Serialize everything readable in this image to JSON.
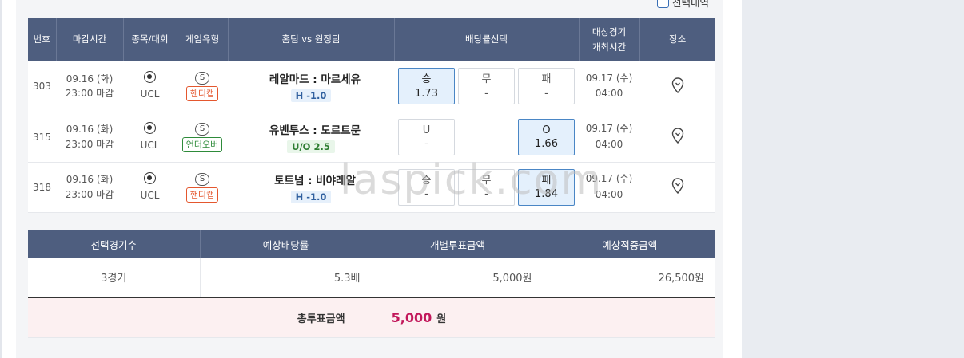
{
  "select_toggle": {
    "label": "선택내역"
  },
  "table": {
    "headers": {
      "no": "번호",
      "deadline": "마감시간",
      "league": "종목/대회",
      "game_type": "게임유형",
      "match": "홈팀 vs 원정팀",
      "odds": "배당률선택",
      "event_time_1": "대상경기",
      "event_time_2": "개최시간",
      "venue": "장소"
    },
    "rows": [
      {
        "no": "303",
        "date": "09.16 (화)",
        "deadline": "23:00 마감",
        "league": "UCL",
        "type_s": "S",
        "type_tag": "핸디캡",
        "teams": "레알마드 : 마르세유",
        "handicap": "H -1.0",
        "odds": [
          {
            "label": "승",
            "value": "1.73",
            "selected": true
          },
          {
            "label": "무",
            "value": "-",
            "selected": false
          },
          {
            "label": "패",
            "value": "-",
            "selected": false
          }
        ],
        "event_date": "09.17 (수)",
        "event_time": "04:00"
      },
      {
        "no": "315",
        "date": "09.16 (화)",
        "deadline": "23:00 마감",
        "league": "UCL",
        "type_s": "S",
        "type_tag": "언더오버",
        "teams": "유벤투스 : 도르트문",
        "handicap": "U/O 2.5",
        "odds": [
          {
            "label": "U",
            "value": "-",
            "selected": false
          },
          {
            "label": "",
            "value": "",
            "selected": false
          },
          {
            "label": "O",
            "value": "1.66",
            "selected": true
          }
        ],
        "event_date": "09.17 (수)",
        "event_time": "04:00"
      },
      {
        "no": "318",
        "date": "09.16 (화)",
        "deadline": "23:00 마감",
        "league": "UCL",
        "type_s": "S",
        "type_tag": "핸디캡",
        "teams": "토트넘 : 비야레알",
        "handicap": "H -1.0",
        "odds": [
          {
            "label": "승",
            "value": "-",
            "selected": false
          },
          {
            "label": "무",
            "value": "-",
            "selected": false
          },
          {
            "label": "패",
            "value": "1.84",
            "selected": true
          }
        ],
        "event_date": "09.17 (수)",
        "event_time": "04:00"
      }
    ]
  },
  "summary": {
    "headers": [
      "선택경기수",
      "예상배당률",
      "개별투표금액",
      "예상적중금액"
    ],
    "values": [
      "3경기",
      "5.3배",
      "5,000원",
      "26,500원"
    ]
  },
  "total": {
    "label": "총투표금액",
    "amount": "5,000",
    "unit": "원"
  },
  "watermark": "laspick.com",
  "colors": {
    "header": "#4e5e7f",
    "selected": "#e4f0fc",
    "total_amount": "#c2185b",
    "tag_orange": "#e4572e",
    "tag_green": "#2e8b3a"
  }
}
